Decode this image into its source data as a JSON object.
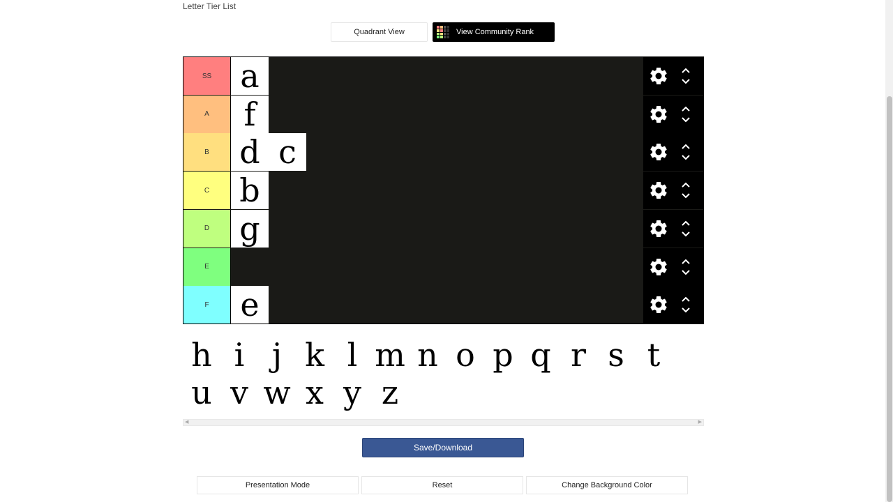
{
  "page": {
    "title": "Letter Tier List"
  },
  "top_buttons": {
    "quadrant": "Quadrant View",
    "community": "View Community Rank"
  },
  "tiers": [
    {
      "label": "SS",
      "color": "#ff7f7f",
      "items": [
        "a"
      ]
    },
    {
      "label": "A",
      "color": "#ffbf7f",
      "items": [
        "f"
      ]
    },
    {
      "label": "B",
      "color": "#ffdf7f",
      "items": [
        "d",
        "c"
      ]
    },
    {
      "label": "C",
      "color": "#ffff7f",
      "items": [
        "b"
      ]
    },
    {
      "label": "D",
      "color": "#bfff7f",
      "items": [
        "g"
      ]
    },
    {
      "label": "E",
      "color": "#7fff7f",
      "items": []
    },
    {
      "label": "F",
      "color": "#7fffff",
      "items": [
        "e"
      ]
    }
  ],
  "pool": [
    "h",
    "i",
    "j",
    "k",
    "l",
    "m",
    "n",
    "o",
    "p",
    "q",
    "r",
    "s",
    "t",
    "u",
    "v",
    "w",
    "x",
    "y",
    "z"
  ],
  "actions": {
    "save": "Save/Download",
    "presentation": "Presentation Mode",
    "reset": "Reset",
    "background": "Change Background Color"
  },
  "icons": {
    "settings": "gear-icon",
    "up": "chevron-up-icon",
    "down": "chevron-down-icon",
    "community": "grid-icon"
  }
}
